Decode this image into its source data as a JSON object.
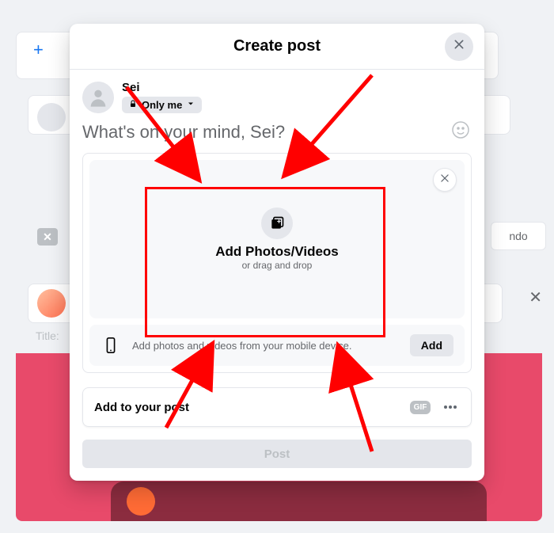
{
  "modal": {
    "title": "Create post",
    "close_aria": "Close"
  },
  "profile": {
    "name": "Sei",
    "audience_label": "Only me"
  },
  "composer": {
    "placeholder": "What's on your mind, Sei?"
  },
  "dropzone": {
    "title": "Add Photos/Videos",
    "subtitle": "or drag and drop"
  },
  "mobile": {
    "text": "Add photos and videos from your mobile device.",
    "button": "Add"
  },
  "addto": {
    "label": "Add to your post",
    "gif": "GIF"
  },
  "post_button": "Post",
  "bg": {
    "undo": "ndo",
    "title": "Title:"
  }
}
